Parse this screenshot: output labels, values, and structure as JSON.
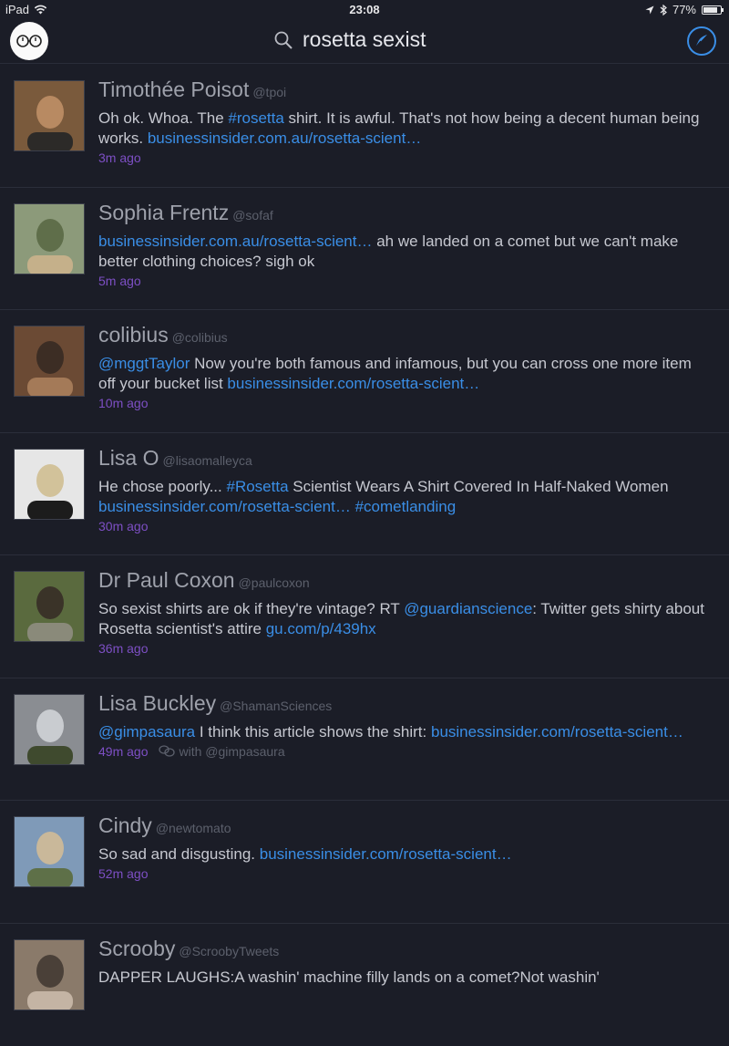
{
  "status": {
    "device": "iPad",
    "time": "23:08",
    "battery": "77%"
  },
  "nav": {
    "search_query": "rosetta sexist",
    "avatar_icon": "glasses-icon",
    "compose_icon": "quill-icon"
  },
  "colors": {
    "background": "#1b1d27",
    "link": "#3a8ee6",
    "timestamp": "#7d4fc4"
  },
  "tweets": [
    {
      "name": "Timothée Poisot",
      "handle": "@tpoi",
      "segments": [
        {
          "t": "Oh ok. Whoa. The ",
          "link": false
        },
        {
          "t": "#rosetta",
          "link": true
        },
        {
          "t": " shirt. It is awful. That's not how being a decent human being works. ",
          "link": false
        },
        {
          "t": "businessinsider.com.au/rosetta-scient…",
          "link": true
        }
      ],
      "time": "3m ago"
    },
    {
      "name": "Sophia Frentz",
      "handle": "@sofaf",
      "segments": [
        {
          "t": "businessinsider.com.au/rosetta-scient…",
          "link": true
        },
        {
          "t": " ah we landed on a comet but we can't make better clothing choices? sigh ok",
          "link": false
        }
      ],
      "time": "5m ago"
    },
    {
      "name": "colibius",
      "handle": "@colibius",
      "segments": [
        {
          "t": "@mggtTaylor",
          "link": true
        },
        {
          "t": " Now you're both famous and infamous, but you can cross one more item off your bucket list ",
          "link": false
        },
        {
          "t": "businessinsider.com/rosetta-scient…",
          "link": true
        }
      ],
      "time": "10m ago"
    },
    {
      "name": "Lisa O",
      "handle": "@lisaomalleyca",
      "segments": [
        {
          "t": "He chose poorly... ",
          "link": false
        },
        {
          "t": "#Rosetta",
          "link": true
        },
        {
          "t": " Scientist Wears A Shirt Covered In Half-Naked Women ",
          "link": false
        },
        {
          "t": "businessinsider.com/rosetta-scient…",
          "link": true
        },
        {
          "t": " ",
          "link": false
        },
        {
          "t": "#cometlanding",
          "link": true
        }
      ],
      "time": "30m ago"
    },
    {
      "name": "Dr Paul Coxon",
      "handle": "@paulcoxon",
      "segments": [
        {
          "t": "So sexist shirts are ok if they're vintage? RT ",
          "link": false
        },
        {
          "t": "@guardianscience",
          "link": true
        },
        {
          "t": ": Twitter gets shirty about Rosetta scientist's attire ",
          "link": false
        },
        {
          "t": "gu.com/p/439hx",
          "link": true
        }
      ],
      "time": "36m ago"
    },
    {
      "name": "Lisa Buckley",
      "handle": "@ShamanSciences",
      "segments": [
        {
          "t": "@gimpasaura",
          "link": true
        },
        {
          "t": " I think this article shows the shirt: ",
          "link": false
        },
        {
          "t": "businessinsider.com/rosetta-scient…",
          "link": true
        }
      ],
      "time": "49m ago",
      "conversation": "with @gimpasaura"
    },
    {
      "name": "Cindy",
      "handle": "@newtomato",
      "segments": [
        {
          "t": "So sad and disgusting. ",
          "link": false
        },
        {
          "t": "businessinsider.com/rosetta-scient…",
          "link": true
        }
      ],
      "time": "52m ago"
    },
    {
      "name": "Scrooby",
      "handle": "@ScroobyTweets",
      "segments": [
        {
          "t": "DAPPER LAUGHS:A washin' machine filly lands on a comet?Not washin'",
          "link": false
        }
      ],
      "time": ""
    }
  ]
}
